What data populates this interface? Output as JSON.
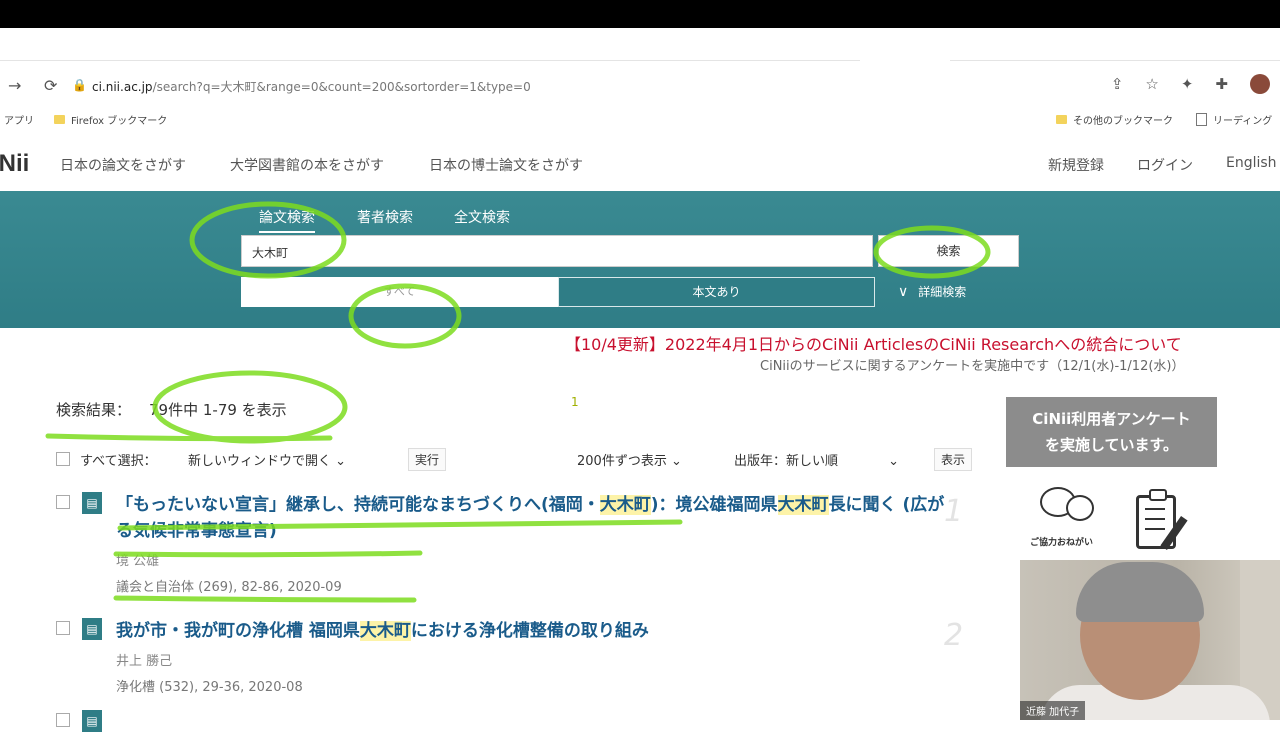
{
  "browser": {
    "url_host": "ci.nii.ac.jp",
    "url_path": "/search?q=大木町&range=0&count=200&sortorder=1&type=0",
    "bookmarks": [
      "アプリ",
      "Firefox ブックマーク"
    ],
    "bookmarks_right": [
      "その他のブックマーク",
      "リーディング"
    ]
  },
  "site": {
    "logo": "iNii",
    "nav": [
      "日本の論文をさがす",
      "大学図書館の本をさがす",
      "日本の博士論文をさがす"
    ],
    "nav_right": [
      "新規登録",
      "ログイン",
      "English"
    ]
  },
  "search": {
    "tabs": [
      "論文検索",
      "著者検索",
      "全文検索"
    ],
    "query": "大木町",
    "button": "検索",
    "option_all": "すべて",
    "option_fulltext": "本文あり",
    "advanced": "詳細検索"
  },
  "notices": {
    "line1": "【10/4更新】2022年4月1日からのCiNii ArticlesのCiNii Researchへの統合について",
    "line2": "CiNiiのサービスに関するアンケートを実施中です（12/1(水)-1/12(水)）"
  },
  "results": {
    "label": "検索結果：",
    "count_text": "79件中 1-79 を表示",
    "marker": "1",
    "select_all": "すべて選択：",
    "open_in": "新しいウィンドウで開く",
    "run": "実行",
    "per_page": "200件ずつ表示",
    "sort": "出版年：新しい順",
    "show": "表示",
    "items": [
      {
        "title_pre": "「もったいない宣言」継承し、持続可能なまちづくりへ(福岡・",
        "title_hl": "大木町",
        "title_mid": ")：境公雄福岡県",
        "title_hl2": "大木町",
        "title_post": "長に聞く (広がる気候非常事態宣言)",
        "author": "境 公雄",
        "source": "議会と自治体 (269), 82-86, 2020-09",
        "num": "1"
      },
      {
        "title_pre": "我が市・我が町の浄化槽 福岡県",
        "title_hl": "大木町",
        "title_post": "における浄化槽整備の取り組み",
        "author": "井上 勝己",
        "source": "浄化槽 (532), 29-36, 2020-08",
        "num": "2"
      }
    ]
  },
  "sidebar": {
    "survey_line1": "CiNii利用者アンケート",
    "survey_line2": "を実施しています。",
    "cooperation": "ご協力おねがい"
  },
  "webcam": {
    "name": "近藤 加代子"
  },
  "colors": {
    "band": "#2f7d86",
    "title": "#1a5b8a",
    "notice": "#c8102e",
    "highlight": "#fdf3a8",
    "annotation": "#7ddc1f"
  }
}
